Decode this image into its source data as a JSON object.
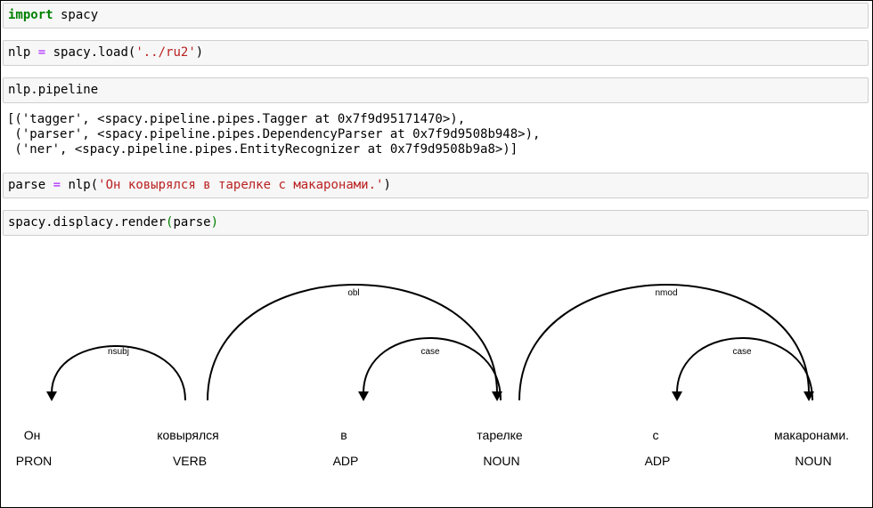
{
  "cells": {
    "c1": {
      "kw": "import",
      "rest": " spacy"
    },
    "c2": {
      "a": "nlp ",
      "op": "=",
      "b": " spacy.load(",
      "str": "'../ru2'",
      "c": ")"
    },
    "c3": {
      "text": "nlp.pipeline"
    },
    "c4": {
      "a": "parse ",
      "op": "=",
      "b": " nlp(",
      "str": "'Он ковырялся в тарелке с макаронами.'",
      "c": ")"
    },
    "c5": {
      "a": "spacy.displacy.render",
      "p1": "(",
      "b": "parse",
      "p2": ")"
    }
  },
  "output": {
    "line1": "[('tagger', <spacy.pipeline.pipes.Tagger at 0x7f9d95171470>),",
    "line2": " ('parser', <spacy.pipeline.pipes.DependencyParser at 0x7f9d9508b948>),",
    "line3": " ('ner', <spacy.pipeline.pipes.EntityRecognizer at 0x7f9d9508b9a8>)]"
  },
  "parse": {
    "tokens": [
      {
        "text": "Он",
        "tag": "PRON"
      },
      {
        "text": "ковырялся",
        "tag": "VERB"
      },
      {
        "text": "в",
        "tag": "ADP"
      },
      {
        "text": "тарелке",
        "tag": "NOUN"
      },
      {
        "text": "с",
        "tag": "ADP"
      },
      {
        "text": "макаронами.",
        "tag": "NOUN"
      }
    ],
    "arcs": [
      {
        "label": "nsubj"
      },
      {
        "label": "obl"
      },
      {
        "label": "case"
      },
      {
        "label": "nmod"
      },
      {
        "label": "case"
      }
    ]
  }
}
